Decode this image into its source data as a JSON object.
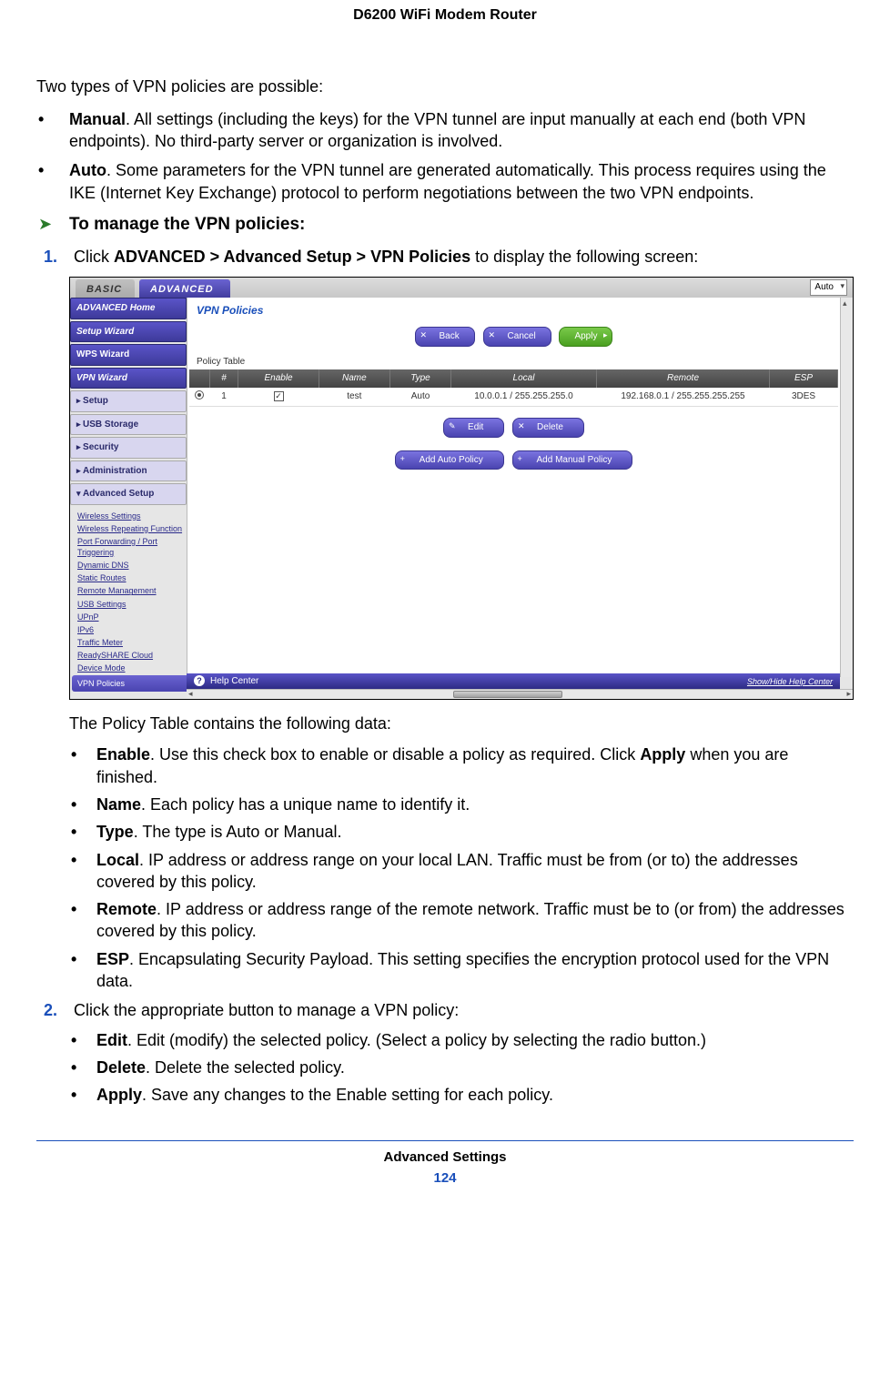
{
  "header": {
    "title": "D6200 WiFi Modem Router"
  },
  "intro": "Two types of VPN policies are possible:",
  "vpn_types": [
    {
      "bold": "Manual",
      "text": ". All settings (including the keys) for the VPN tunnel are input manually at each end (both VPN endpoints). No third-party server or organization is involved."
    },
    {
      "bold": "Auto",
      "text": ". Some parameters for the VPN tunnel are generated automatically. This process requires using the IKE (Internet Key Exchange) protocol to perform negotiations between the two VPN endpoints."
    }
  ],
  "procedure_title": "To manage the VPN policies:",
  "step1": {
    "num": "1.",
    "pre": "Click ",
    "bold": "ADVANCED > Advanced Setup > VPN Policies",
    "post": " to display the following screen:",
    "subtext": "The Policy Table contains the following data:",
    "fields": [
      {
        "bold": "Enable",
        "text": ". Use this check box to enable or disable a policy as required. Click ",
        "bold2": "Apply",
        "text2": " when you are finished."
      },
      {
        "bold": "Name",
        "text": ". Each policy has a unique name to identify it."
      },
      {
        "bold": "Type",
        "text": ". The type is Auto or Manual."
      },
      {
        "bold": "Local",
        "text": ". IP address or address range on your local LAN. Traffic must be from (or to) the addresses covered by this policy."
      },
      {
        "bold": "Remote",
        "text": ". IP address or address range of the remote network. Traffic must be to (or from) the addresses covered by this policy."
      },
      {
        "bold": "ESP",
        "text": ". Encapsulating Security Payload. This setting specifies the encryption protocol used for the VPN data."
      }
    ]
  },
  "step2": {
    "num": "2.",
    "text": "Click the appropriate button to manage a VPN policy:",
    "buttons": [
      {
        "bold": "Edit",
        "text": ". Edit (modify) the selected policy. (Select a policy by selecting the radio button.)"
      },
      {
        "bold": "Delete",
        "text": ". Delete the selected policy."
      },
      {
        "bold": "Apply",
        "text": ". Save any changes to the Enable setting for each policy."
      }
    ]
  },
  "screenshot": {
    "tabs": {
      "basic": "BASIC",
      "advanced": "ADVANCED"
    },
    "dropdown": "Auto",
    "nav": {
      "home": "ADVANCED Home",
      "setup_wizard": "Setup Wizard",
      "wps_wizard": "WPS Wizard",
      "vpn_wizard": "VPN Wizard",
      "setup": "Setup",
      "usb": "USB Storage",
      "security": "Security",
      "admin": "Administration",
      "advanced_setup": "Advanced Setup",
      "sub": [
        "Wireless Settings",
        "Wireless Repeating Function",
        "Port Forwarding / Port Triggering",
        "Dynamic DNS",
        "Static Routes",
        "Remote Management",
        "USB Settings",
        "UPnP",
        "IPv6",
        "Traffic Meter",
        "ReadySHARE Cloud",
        "Device Mode"
      ],
      "active": "VPN Policies"
    },
    "main": {
      "title": "VPN Policies",
      "back": "Back",
      "cancel": "Cancel",
      "apply": "Apply",
      "policy_table": "Policy Table",
      "cols": {
        "num": "#",
        "enable": "Enable",
        "name": "Name",
        "type": "Type",
        "local": "Local",
        "remote": "Remote",
        "esp": "ESP"
      },
      "row": {
        "num": "1",
        "name": "test",
        "type": "Auto",
        "local": "10.0.0.1 / 255.255.255.0",
        "remote": "192.168.0.1 / 255.255.255.255",
        "esp": "3DES"
      },
      "edit": "Edit",
      "delete": "Delete",
      "add_auto": "Add Auto Policy",
      "add_manual": "Add Manual Policy"
    },
    "help": {
      "label": "Help Center",
      "show_hide": "Show/Hide Help Center"
    }
  },
  "footer": {
    "title": "Advanced Settings",
    "page": "124"
  }
}
